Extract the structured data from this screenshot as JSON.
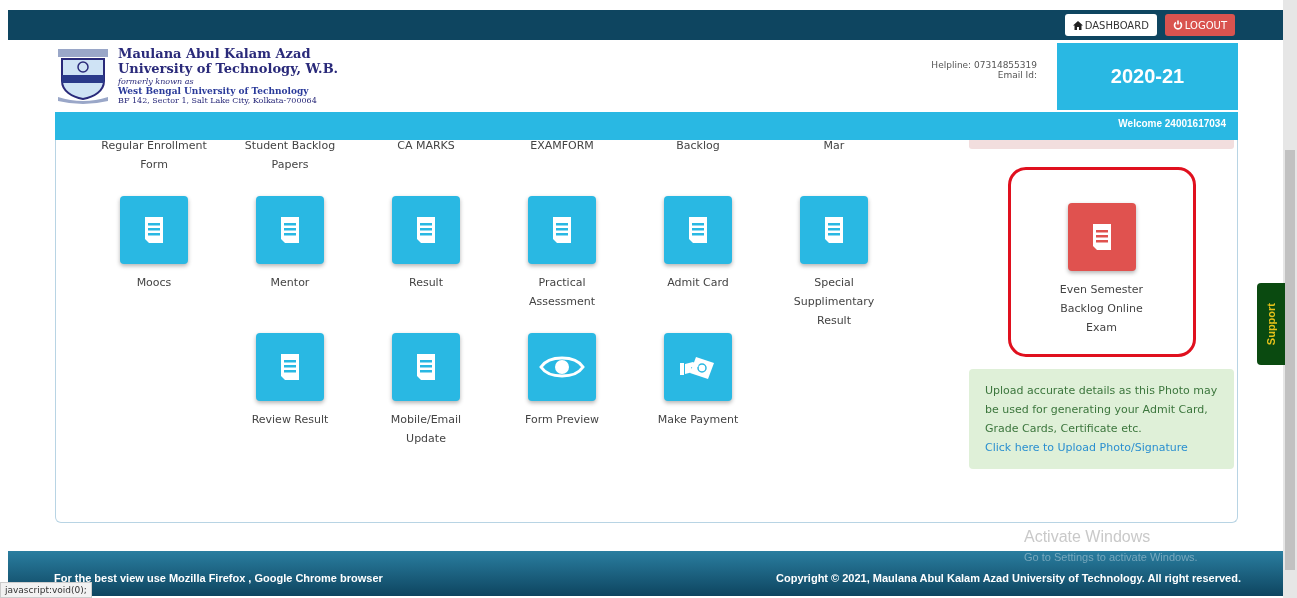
{
  "top_bar": {
    "buttons": [
      {
        "kind": "dashboard",
        "label": "DASHBOARD"
      },
      {
        "kind": "logout",
        "label": "LOGOUT"
      }
    ]
  },
  "header": {
    "logo": {
      "line_1": "Maulana Abul Kalam Azad",
      "line_2": "University of Technology, W.B.",
      "line_3": "formerly known as",
      "line_4": "West Bengal University of Technology",
      "line_5": "BF 142, Sector 1, Salt Lake City, Kolkata-700064"
    },
    "helpline": "Helpline: 07314855319",
    "email": "Email Id:",
    "session": "2020-21",
    "welcome": "Welcome 24001617034"
  },
  "top_row_labels": [
    "Regular Enrollment Form",
    "Student Backlog Papers",
    "CA MARKS",
    "EXAMFORM",
    "Backlog",
    "Mar"
  ],
  "tiles": [
    {
      "label": "Moocs",
      "kind": "document",
      "color": "#29b8e3"
    },
    {
      "label": "Mentor",
      "kind": "document",
      "color": "#29b8e3"
    },
    {
      "label": "Result",
      "kind": "document",
      "color": "#29b8e3"
    },
    {
      "label": "Practical Assessment",
      "kind": "document",
      "color": "#29b8e3"
    },
    {
      "label": "Admit Card",
      "kind": "document",
      "color": "#29b8e3"
    },
    {
      "label": "Special Supplimentary Result",
      "kind": "document",
      "color": "#29b8e3"
    },
    {
      "label": "Review Result",
      "kind": "document",
      "color": "#29b8e3"
    },
    {
      "label": "Mobile/Email Update",
      "kind": "document",
      "color": "#29b8e3"
    },
    {
      "label": "Form Preview",
      "kind": "eye",
      "color": "#29b8e3"
    },
    {
      "label": "Make Payment",
      "kind": "payment",
      "color": "#29b8e3"
    }
  ],
  "featured_tile": {
    "label": "Even Semester Backlog Online Exam",
    "kind": "document",
    "color": "#e0524f",
    "highlighted": true
  },
  "notice": {
    "text": "Upload accurate details as this Photo may be used for generating your Admit Card, Grade Cards, Certificate etc.",
    "link": "Click here to Upload Photo/Signature"
  },
  "support_tab": "Support",
  "os_overlay": {
    "title": "Activate Windows",
    "subtitle": "Go to Settings to activate Windows."
  },
  "footer": {
    "left": "For the best view use Mozilla Firefox , Google Chrome browser",
    "right": "Copyright © 2021, Maulana Abul Kalam Azad University of Technology. All right reserved."
  },
  "status_bar": "javascript:void(0);"
}
